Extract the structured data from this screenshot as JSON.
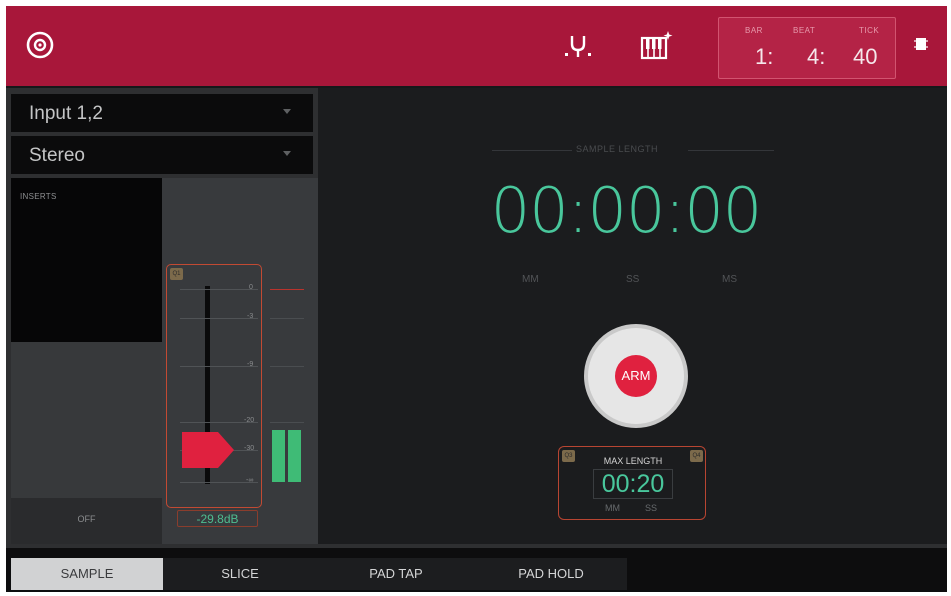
{
  "topbar": {
    "logo_icon": "disc-record-icon",
    "tool_icons": [
      "input-monitor-icon",
      "keyboard-sparkle-icon"
    ],
    "position": {
      "bar_label": "BAR",
      "bar_value": "1:",
      "beat_label": "BEAT",
      "beat_value": "4:",
      "tick_label": "TICK",
      "tick_value": "40"
    },
    "menu_icon": "menu-grip-icon"
  },
  "left": {
    "input_dropdown": "Input 1,2",
    "channel_dropdown": "Stereo",
    "inserts_label": "INSERTS",
    "off_label": "OFF",
    "q1_tag": "Q1",
    "fader_scale": [
      "0",
      "-3",
      "-9",
      "-20",
      "-30",
      "-∞"
    ],
    "gain_readout": "-29.8dB",
    "gain_level_fraction": 0.12
  },
  "right": {
    "sample_length_label": "SAMPLE LENGTH",
    "time": "00:00:00",
    "units": [
      "MM",
      "SS",
      "MS"
    ],
    "arm_label": "ARM",
    "max_length_label": "MAX LENGTH",
    "max_length_value": "00:20",
    "max_units": [
      "MM",
      "SS"
    ],
    "q3_tag": "Q3",
    "q4_tag": "Q4"
  },
  "tabs": [
    {
      "label": "SAMPLE",
      "active": true
    },
    {
      "label": "SLICE",
      "active": false
    },
    {
      "label": "PAD TAP",
      "active": false
    },
    {
      "label": "PAD HOLD",
      "active": false
    }
  ],
  "colors": {
    "header": "#a8173a",
    "accent_green": "#49c79c",
    "arm_red": "#e0213f",
    "frame_orange": "#c24a33"
  }
}
